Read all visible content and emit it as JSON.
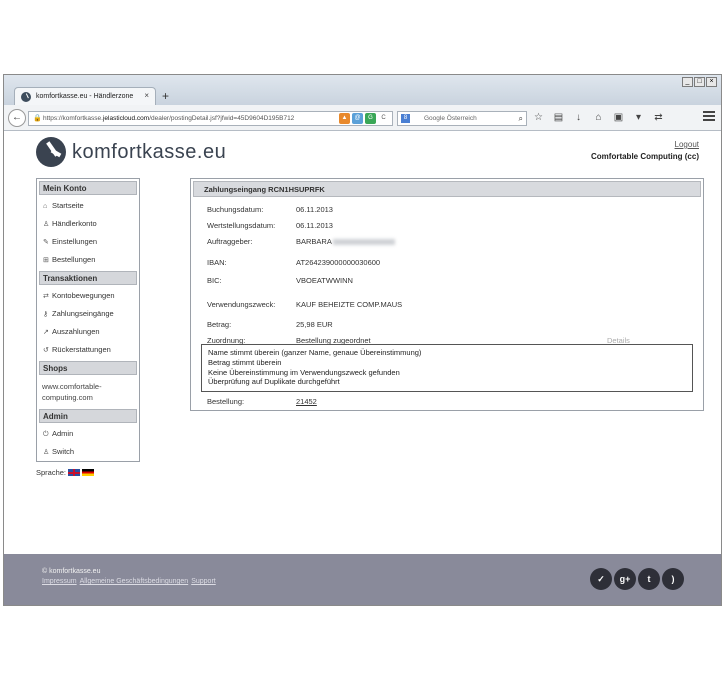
{
  "browser": {
    "tab_title": "komfortkasse.eu - Händlerzone",
    "tab_close": "×",
    "new_tab": "+",
    "url_prefix": "https://komfortkasse.",
    "url_host": "jelasticloud.com",
    "url_rest": "/dealer/postingDetail.jsf?jfwid=45D9604D195B712",
    "search_placeholder": "Google Österreich"
  },
  "header": {
    "logo_text": "komfortkasse.eu",
    "logout": "Logout",
    "company": "Comfortable Computing (cc)"
  },
  "sidebar": {
    "sections": {
      "account": "Mein Konto",
      "transactions": "Transaktionen",
      "shops": "Shops",
      "admin": "Admin"
    },
    "items": {
      "startseite": "Startseite",
      "haendlerkonto": "Händlerkonto",
      "einstellungen": "Einstellungen",
      "bestellungen": "Bestellungen",
      "kontobewegungen": "Kontobewegungen",
      "zahlungseingaenge": "Zahlungseingänge",
      "auszahlungen": "Auszahlungen",
      "rueckerstattungen": "Rückerstattungen",
      "shop_url": "www.comfortable-computing.com",
      "admin": "Admin",
      "switch": "Switch"
    },
    "language_label": "Sprache:"
  },
  "posting": {
    "title": "Zahlungseingang RCN1HSUPRFK",
    "fields": {
      "buchungsdatum_label": "Buchungsdatum:",
      "buchungsdatum": "06.11.2013",
      "wertstellung_label": "Wertstellungsdatum:",
      "wertstellung": "06.11.2013",
      "auftraggeber_label": "Auftraggeber:",
      "auftraggeber": "BARBARA",
      "iban_label": "IBAN:",
      "iban": "AT264239000000030600",
      "bic_label": "BIC:",
      "bic": "VBOEATWWINN",
      "zweck_label": "Verwendungszweck:",
      "zweck": "KAUF BEHEIZTE COMP.MAUS",
      "betrag_label": "Betrag:",
      "betrag": "25,98 EUR",
      "zuordnung_label": "Zuordnung:",
      "zuordnung": "Bestellung zugeordnet",
      "details": "Details",
      "bestellung_label": "Bestellung:",
      "bestellung": "21452"
    },
    "match_lines": [
      "Name stimmt überein (ganzer Name, genaue Übereinstimmung)",
      "Betrag stimmt überein",
      "Keine Übereinstimmung im Verwendungszweck gefunden",
      "Überprüfung auf Duplikate durchgeführt"
    ]
  },
  "footer": {
    "copyright": "© komfortkasse.eu",
    "links": [
      "Impressum",
      "Allgemeine Geschäftsbedingungen",
      "Support"
    ]
  }
}
